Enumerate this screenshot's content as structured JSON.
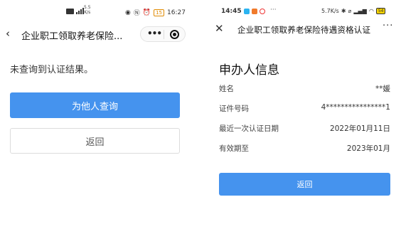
{
  "left_screen": {
    "status_bar": {
      "speed_top": "5.5",
      "speed_bottom": "K/s",
      "battery": "15",
      "time": "16:27"
    },
    "nav": {
      "title": "企业职工领取养老保险..."
    },
    "result_text": "未查询到认证结果。",
    "query_for_others_button": "为他人查询",
    "back_button": "返回"
  },
  "right_screen": {
    "status_bar": {
      "time": "14:45",
      "dots": "···",
      "speed": "5.7K/s",
      "battery": "54"
    },
    "nav": {
      "title": "企业职工领取养老保险待遇资格认证"
    },
    "section_title": "申办人信息",
    "info": [
      {
        "label": "姓名",
        "value": "**媛"
      },
      {
        "label": "证件号码",
        "value": "4****************1"
      },
      {
        "label": "最近一次认证日期",
        "value": "2022年01月11日"
      },
      {
        "label": "有效期至",
        "value": "2023年01月"
      }
    ],
    "back_button": "返回"
  },
  "colors": {
    "primary_button": "#4593ee",
    "battery_low": "#e08a00"
  }
}
